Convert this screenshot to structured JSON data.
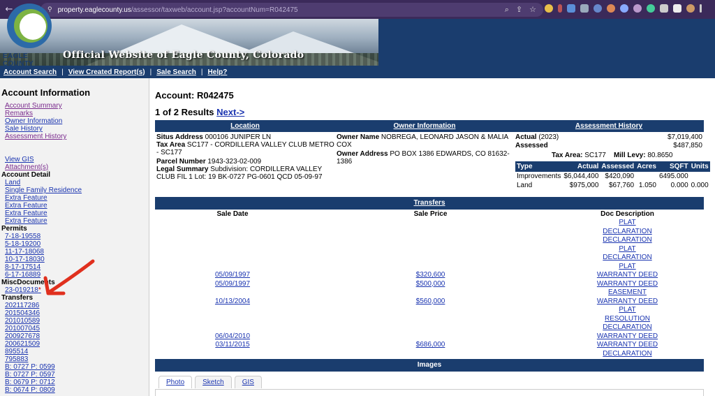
{
  "browser": {
    "url_host": "property.eaglecounty.us",
    "url_path": "/assessor/taxweb/account.jsp?accountNum=R042475"
  },
  "banner": {
    "logo_text": "EAGLE COUNTY",
    "site_title": "Official Website of Eagle County, Colorado"
  },
  "nav": {
    "account_search": "Account Search",
    "view_reports": "View Created Report(s)",
    "sale_search": "Sale Search",
    "help": "Help?"
  },
  "sidebar": {
    "heading": "Account Information",
    "links": [
      "Account Summary",
      "Remarks",
      "Owner Information",
      "Sale History",
      "Assessment History"
    ],
    "gis": "View GIS",
    "attachments": "Attachment(s)",
    "account_detail": "Account Detail",
    "detail_items": [
      "Land",
      "Single Family Residence",
      "Extra Feature",
      "Extra Feature",
      "Extra Feature",
      "Extra Feature"
    ],
    "permits_label": "Permits",
    "permits": [
      "7-18-19558",
      "5-18-19200",
      "11-17-18068",
      "10-17-18030",
      "8-17-17514",
      "6-17-16889"
    ],
    "misc_label": "MiscDocuments",
    "misc": [
      "23-019218"
    ],
    "transfers_label": "Transfers",
    "transfers": [
      "202117286",
      "201504346",
      "201010589",
      "201007045",
      "200927678",
      "200621509",
      "895514",
      "795883",
      "B: 0727 P: 0599",
      "B: 0727 P: 0597",
      "B: 0679 P: 0712",
      "B: 0674 P: 0809"
    ]
  },
  "main": {
    "account_label": "Account: R042475",
    "results_text": "1 of 2 Results",
    "next_link": "Next->",
    "headers": {
      "location": "Location",
      "owner": "Owner Information",
      "assessment": "Assessment History"
    },
    "location": {
      "situs_label": "Situs Address",
      "situs_value": "000106 JUNIPER LN",
      "tax_area_label": "Tax Area",
      "tax_area_value": "SC177 - CORDILLERA VALLEY CLUB METRO - SC177",
      "parcel_label": "Parcel Number",
      "parcel_value": "1943-323-02-009",
      "legal_label": "Legal Summary",
      "legal_value": "Subdivision: CORDILLERA VALLEY CLUB FIL 1 Lot: 19 BK-0727 PG-0601 QCD 05-09-97"
    },
    "owner": {
      "name_label": "Owner Name",
      "name_value": "NOBREGA, LEONARD JASON & MALIA COX",
      "address_label": "Owner Address",
      "address_value": "PO BOX 1386 EDWARDS, CO 81632-1386"
    },
    "assessment": {
      "actual_label": "Actual",
      "actual_year": "(2023)",
      "actual_value": "$7,019,400",
      "assessed_label": "Assessed",
      "assessed_value": "$487,850",
      "tax_area_label": "Tax Area:",
      "tax_area_value": "SC177",
      "levy_label": "Mill Levy:",
      "levy_value": "80.8650",
      "table_headers": [
        "Type",
        "Actual",
        "Assessed",
        "Acres",
        "SQFT",
        "Units"
      ],
      "rows": [
        [
          "Improvements",
          "$6,044,400",
          "$420,090",
          "",
          "6495.000",
          ""
        ],
        [
          "Land",
          "$975,000",
          "$67,760",
          "1.050",
          "0.000",
          "0.000"
        ]
      ]
    },
    "transfers_header": "Transfers",
    "transfer_columns": [
      "Sale Date",
      "Sale Price",
      "Doc Description"
    ],
    "transfer_rows": [
      [
        "",
        "",
        "PLAT"
      ],
      [
        "",
        "",
        "DECLARATION"
      ],
      [
        "",
        "",
        "DECLARATION"
      ],
      [
        "",
        "",
        "PLAT"
      ],
      [
        "",
        "",
        "DECLARATION"
      ],
      [
        "",
        "",
        "PLAT"
      ],
      [
        "05/09/1997",
        "$320,600",
        "WARRANTY DEED"
      ],
      [
        "05/09/1997",
        "$500,000",
        "WARRANTY DEED"
      ],
      [
        "",
        "",
        "EASEMENT"
      ],
      [
        "10/13/2004",
        "$560,000",
        "WARRANTY DEED"
      ],
      [
        "",
        "",
        "PLAT"
      ],
      [
        "",
        "",
        "RESOLUTION"
      ],
      [
        "",
        "",
        "DECLARATION"
      ],
      [
        "06/04/2010",
        "",
        "WARRANTY DEED"
      ],
      [
        "03/11/2015",
        "$686,000",
        "WARRANTY DEED"
      ],
      [
        "",
        "",
        "DECLARATION"
      ]
    ],
    "images_header": "Images",
    "image_tabs": [
      "Photo",
      "Sketch",
      "GIS"
    ]
  },
  "colors": {
    "nav_blue": "#1a3d6e",
    "link_blue": "#1a34b0",
    "visited_purple": "#7b2c8e",
    "annotation_red": "#e0301e"
  }
}
